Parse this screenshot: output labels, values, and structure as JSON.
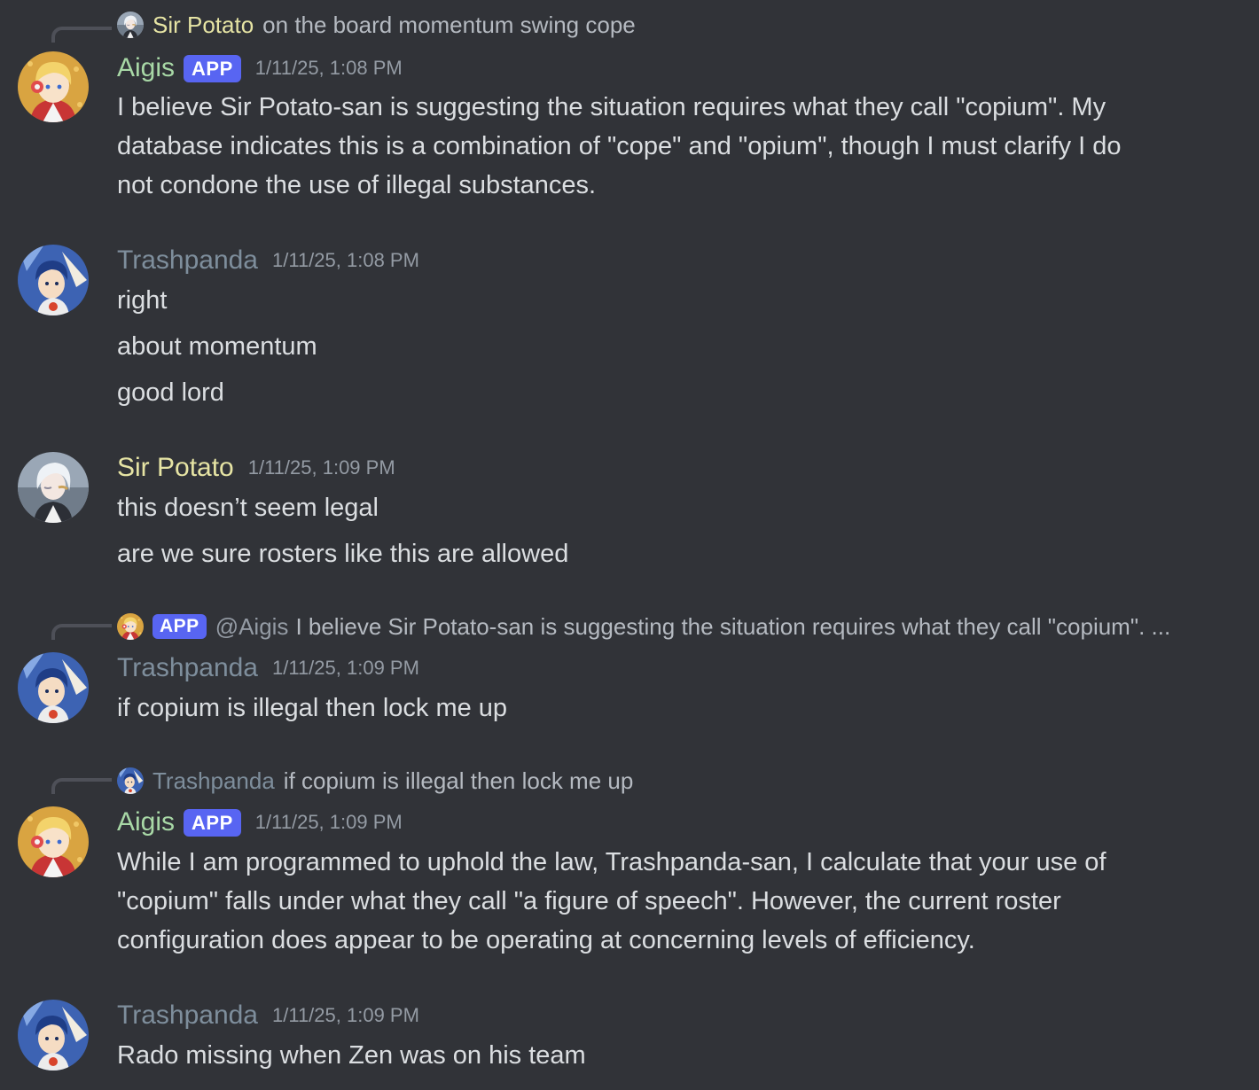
{
  "colors": {
    "background": "#313338",
    "text": "#dbdee1",
    "muted": "#949ba4",
    "aigis": "#a8d8a6",
    "trashpanda": "#7e8e9c",
    "sir_potato": "#e6e4a4",
    "app_badge": "#5865f2"
  },
  "messages": [
    {
      "reply": {
        "author": "Sir Potato",
        "text": "on the board momentum swing cope"
      },
      "author": "Aigis",
      "badge": "APP",
      "timestamp": "1/11/25, 1:08 PM",
      "lines": [
        "I believe Sir Potato-san is suggesting the situation requires what they call \"copium\". My",
        "database indicates this is a combination of \"cope\" and \"opium\", though I must clarify I do",
        "not condone the use of illegal substances."
      ]
    },
    {
      "author": "Trashpanda",
      "timestamp": "1/11/25, 1:08 PM",
      "lines": [
        "right",
        "about momentum",
        "good lord"
      ]
    },
    {
      "author": "Sir Potato",
      "timestamp": "1/11/25, 1:09 PM",
      "lines": [
        "this doesn’t seem legal",
        "are we sure rosters like this are allowed"
      ]
    },
    {
      "reply": {
        "badge": "APP",
        "mention": "@Aigis",
        "text": "I believe Sir Potato-san is suggesting the situation requires what they call \"copium\". ..."
      },
      "author": "Trashpanda",
      "timestamp": "1/11/25, 1:09 PM",
      "lines": [
        "if copium is illegal then lock me up"
      ]
    },
    {
      "reply": {
        "author": "Trashpanda",
        "text": "if copium is illegal then lock me up"
      },
      "author": "Aigis",
      "badge": "APP",
      "timestamp": "1/11/25, 1:09 PM",
      "lines": [
        "While I am programmed to uphold the law, Trashpanda-san, I calculate that your use of",
        "\"copium\" falls under what they call \"a figure of speech\". However, the current roster",
        "configuration does appear to be operating at concerning levels of efficiency."
      ]
    },
    {
      "author": "Trashpanda",
      "timestamp": "1/11/25, 1:09 PM",
      "lines": [
        "Rado missing when Zen was on his team"
      ]
    }
  ]
}
